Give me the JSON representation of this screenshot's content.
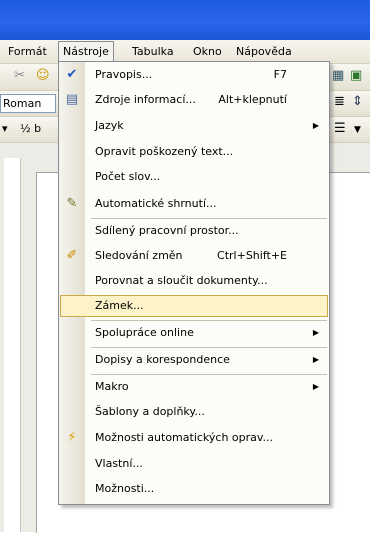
{
  "menubar": {
    "items": [
      {
        "label": "Formát"
      },
      {
        "label": "Nástroje"
      },
      {
        "label": "Tabulka"
      },
      {
        "label": "Okno"
      },
      {
        "label": "Nápověda"
      }
    ]
  },
  "toolbar": {
    "font_name": "Roman",
    "fraction": "½ b"
  },
  "menu": {
    "items": [
      {
        "label": "Pravopis...",
        "shortcut": "F7",
        "icon": "spellcheck-icon"
      },
      {
        "label": "Zdroje informací...",
        "shortcut": "Alt+klepnutí",
        "icon": "research-icon"
      },
      {
        "label": "Jazyk",
        "submenu": true
      },
      {
        "label": "Opravit poškozený text..."
      },
      {
        "label": "Počet slov..."
      },
      {
        "label": "Automatické shrnutí...",
        "icon": "autosummary-icon"
      },
      {
        "label": "Sdílený pracovní prostor..."
      },
      {
        "label": "Sledování změn",
        "shortcut": "Ctrl+Shift+E",
        "icon": "track-changes-icon"
      },
      {
        "label": "Porovnat a sloučit dokumenty..."
      },
      {
        "label": "Zámek...",
        "highlighted": true
      },
      {
        "label": "Spolupráce online",
        "submenu": true
      },
      {
        "label": "Dopisy a korespondence",
        "submenu": true
      },
      {
        "label": "Makro",
        "submenu": true
      },
      {
        "label": "Šablony a doplňky..."
      },
      {
        "label": "Možnosti automatických oprav...",
        "icon": "autocorrect-icon"
      },
      {
        "label": "Vlastní..."
      },
      {
        "label": "Možnosti..."
      }
    ]
  },
  "colors": {
    "highlight": "#fdf3c8",
    "titlebar": "#2a66ea"
  }
}
